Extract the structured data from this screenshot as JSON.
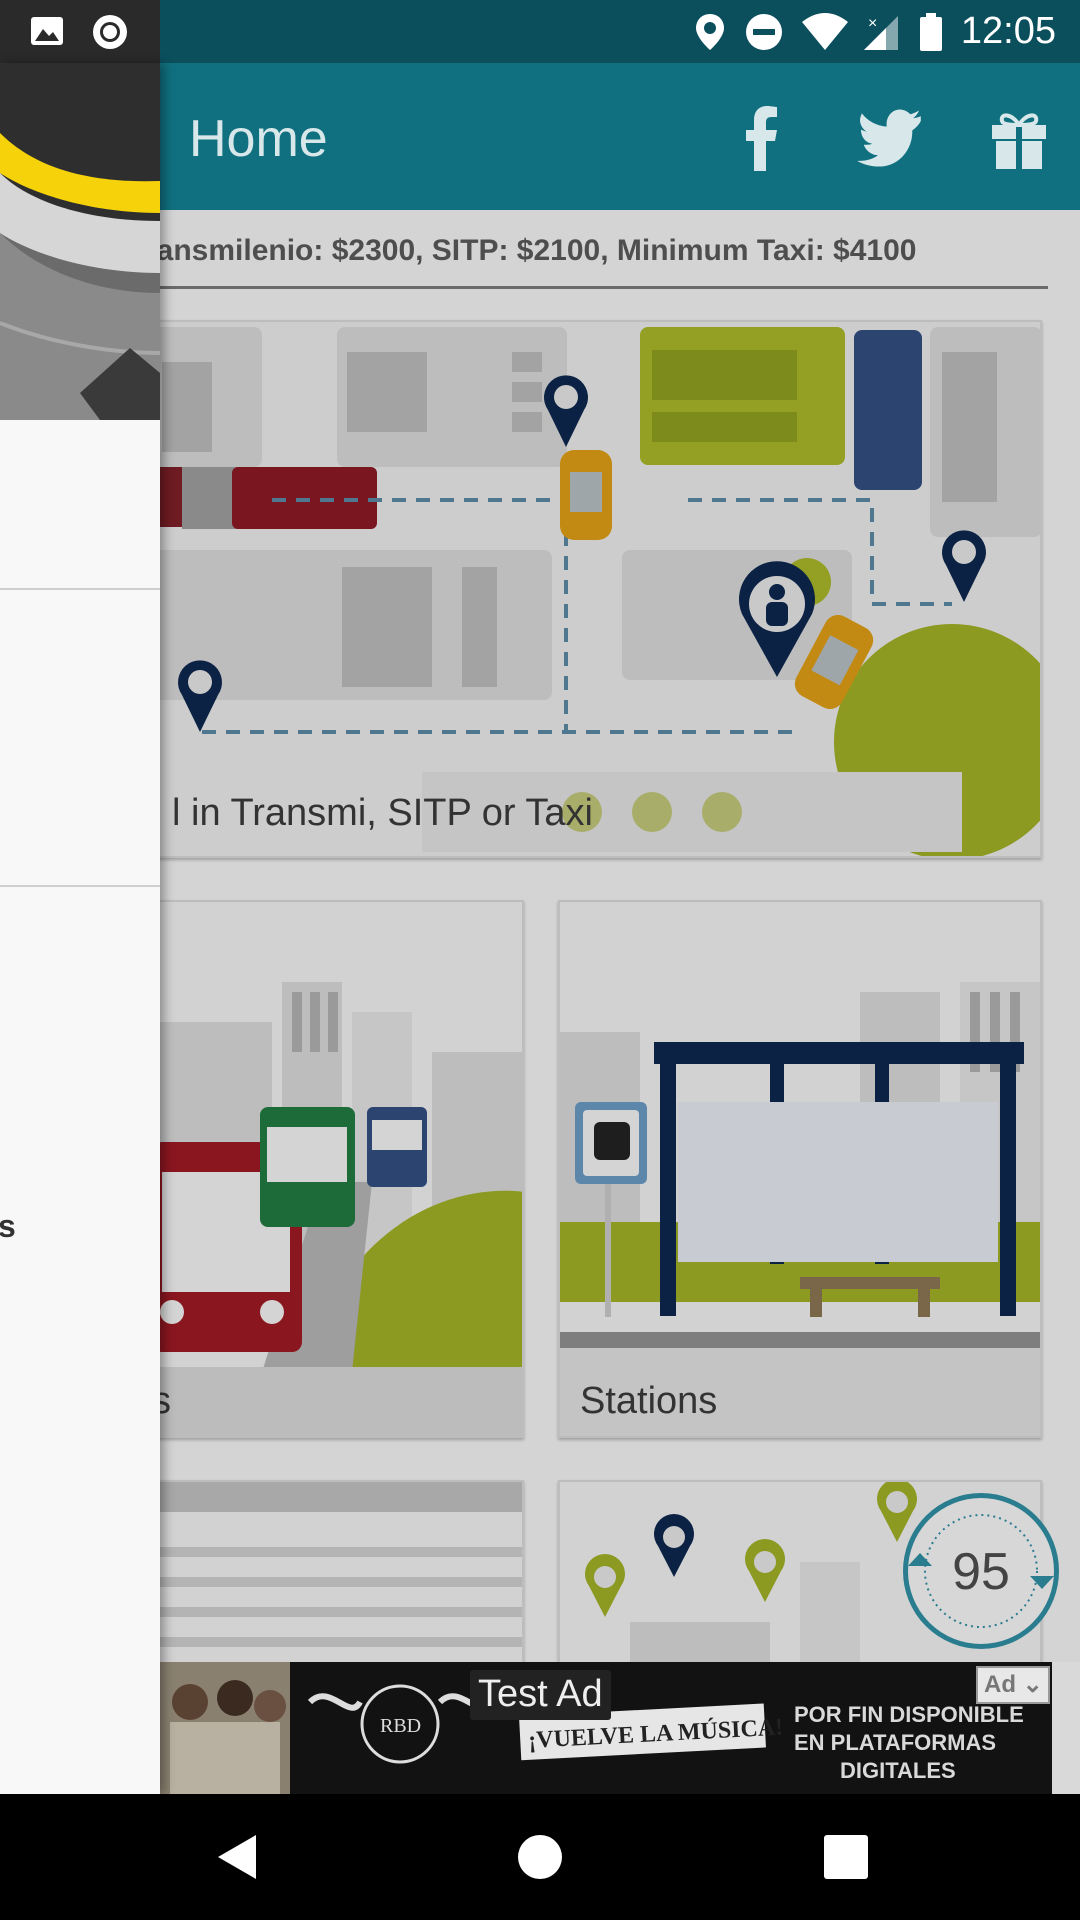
{
  "status_bar": {
    "time": "12:05",
    "icons": [
      "image-icon",
      "record-icon",
      "location-icon",
      "do-not-disturb-icon",
      "wifi-icon",
      "signal-icon",
      "battery-icon"
    ]
  },
  "app_bar": {
    "title": "Home",
    "actions": [
      "facebook-icon",
      "twitter-icon",
      "gift-icon"
    ]
  },
  "fares_text": "ransmilenio: $2300, SITP: $2100, Minimum Taxi: $4100",
  "cards": {
    "route_planner": {
      "label": "l in Transmi, SITP or Taxi"
    },
    "buses": {
      "label": "s"
    },
    "stations": {
      "label": "Stations"
    }
  },
  "speed_badge": {
    "value": "95"
  },
  "ad": {
    "label": "Test Ad",
    "tag": "Ad",
    "slogan": "¡VUELVE LA MÚSICA!",
    "tagline": "POR FIN DISPONIBLE EN PLATAFORMAS DIGITALES",
    "logo": "RBD"
  },
  "drawer": {
    "item_partial": "s"
  },
  "colors": {
    "appbar": "#10707f",
    "statusbar": "#0b4f5d",
    "accent_yellow": "#f5d20a",
    "map_green": "#9aa424"
  }
}
